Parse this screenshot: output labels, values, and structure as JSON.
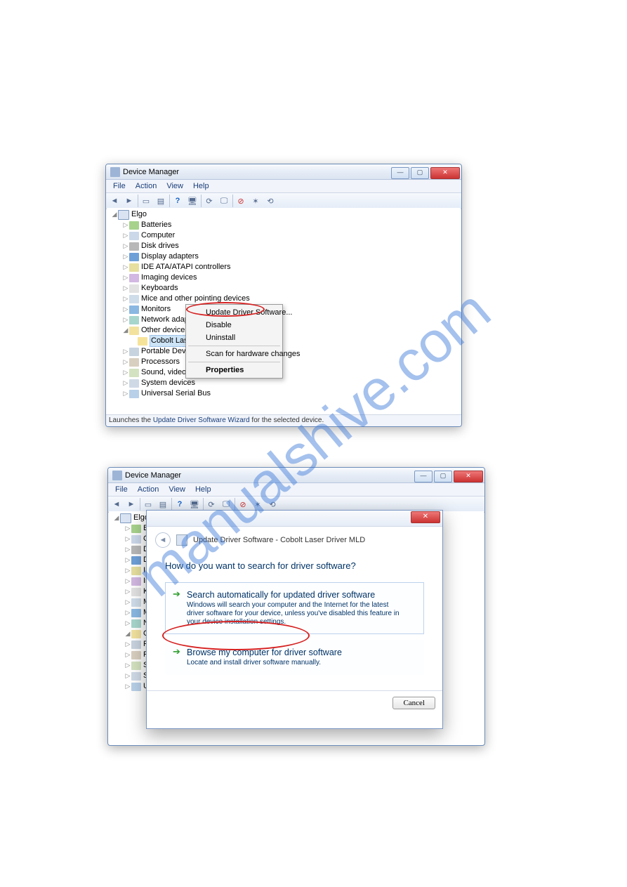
{
  "watermark": "manualshive.com",
  "window1": {
    "title": "Device Manager",
    "winbtns": {
      "min": "—",
      "max": "▢",
      "close": "✕"
    },
    "menus": [
      "File",
      "Action",
      "View",
      "Help"
    ],
    "root": "Elgo",
    "categories": [
      "Batteries",
      "Computer",
      "Disk drives",
      "Display adapters",
      "IDE ATA/ATAPI controllers",
      "Imaging devices",
      "Keyboards",
      "Mice and other pointing devices",
      "Monitors",
      "Network adapters"
    ],
    "other_label": "Other devices",
    "other_child_selected": "Cobolt Laser Dr",
    "tail": [
      "Portable Devices",
      "Processors",
      "Sound, video and g",
      "System devices",
      "Universal Serial Bus"
    ],
    "context_menu": {
      "update": "Update Driver Software...",
      "disable": "Disable",
      "uninstall": "Uninstall",
      "scan": "Scan for hardware changes",
      "properties": "Properties"
    },
    "status_pre": "Launches the ",
    "status_link": "Update Driver Software Wizard",
    "status_post": " for the selected device."
  },
  "window2": {
    "title": "Device Manager",
    "winbtns": {
      "min": "—",
      "max": "▢",
      "close": "✕"
    },
    "menus": [
      "File",
      "Action",
      "View",
      "Help"
    ],
    "root": "Elgo",
    "partial": [
      "Ba",
      "Co",
      "Di",
      "Di",
      "ID",
      "Im",
      "Ke",
      "M",
      "M",
      "Ne",
      "Ot",
      "Po",
      "Pr",
      "So",
      "Sy",
      "Ur"
    ]
  },
  "dialog": {
    "crumb_title": "Update Driver Software - Cobolt Laser Driver MLD",
    "close": "✕",
    "question": "How do you want to search for driver software?",
    "opt1": {
      "title": "Search automatically for updated driver software",
      "desc": "Windows will search your computer and the Internet for the latest driver software for your device, unless you've disabled this feature in your device installation settings."
    },
    "opt2": {
      "title": "Browse my computer for driver software",
      "desc": "Locate and install driver software manually."
    },
    "cancel": "Cancel"
  }
}
